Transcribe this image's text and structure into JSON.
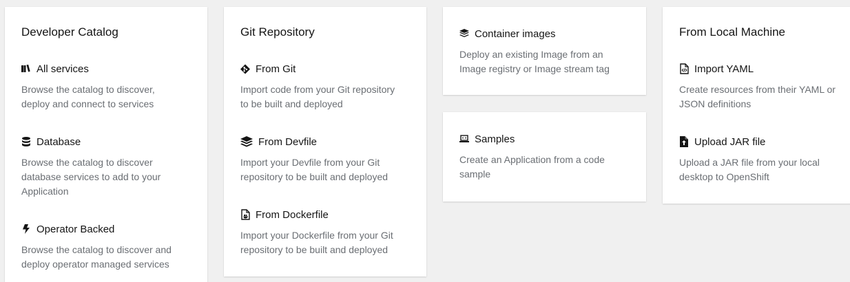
{
  "developer_catalog": {
    "title": "Developer Catalog",
    "items": [
      {
        "icon": "book-icon",
        "label": "All services",
        "desc": [
          "Browse the catalog to discover,",
          "deploy and connect to services"
        ]
      },
      {
        "icon": "database-icon",
        "label": "Database",
        "desc": [
          "Browse the catalog to discover",
          "database services to add to your",
          "Application"
        ]
      },
      {
        "icon": "bolt-icon",
        "label": "Operator Backed",
        "desc": [
          "Browse the catalog to discover and",
          "deploy operator managed services"
        ]
      }
    ]
  },
  "git_repository": {
    "title": "Git Repository",
    "items": [
      {
        "icon": "git-icon",
        "label": "From Git",
        "desc": [
          "Import code from your Git repository",
          "to be built and deployed"
        ]
      },
      {
        "icon": "layers-icon",
        "label": "From Devfile",
        "desc": [
          "Import your Devfile from your Git",
          "repository to be built and deployed"
        ]
      },
      {
        "icon": "docker-file-icon",
        "label": "From Dockerfile",
        "desc": [
          "Import your Dockerfile from your Git",
          "repository to be built and deployed"
        ]
      }
    ]
  },
  "container_images": {
    "icon": "cube-stack-icon",
    "label": "Container images",
    "desc": [
      "Deploy an existing Image from an",
      "Image registry or Image stream tag"
    ]
  },
  "samples": {
    "icon": "laptop-code-icon",
    "label": "Samples",
    "desc": [
      "Create an Application from a code",
      "sample"
    ]
  },
  "from_local_machine": {
    "title": "From Local Machine",
    "items": [
      {
        "icon": "file-code-icon",
        "label": "Import YAML",
        "desc": [
          "Create resources from their YAML or",
          "JSON definitions"
        ]
      },
      {
        "icon": "file-upload-icon",
        "label": "Upload JAR file",
        "desc": [
          "Upload a JAR file from your local",
          "desktop to OpenShift"
        ]
      }
    ]
  }
}
